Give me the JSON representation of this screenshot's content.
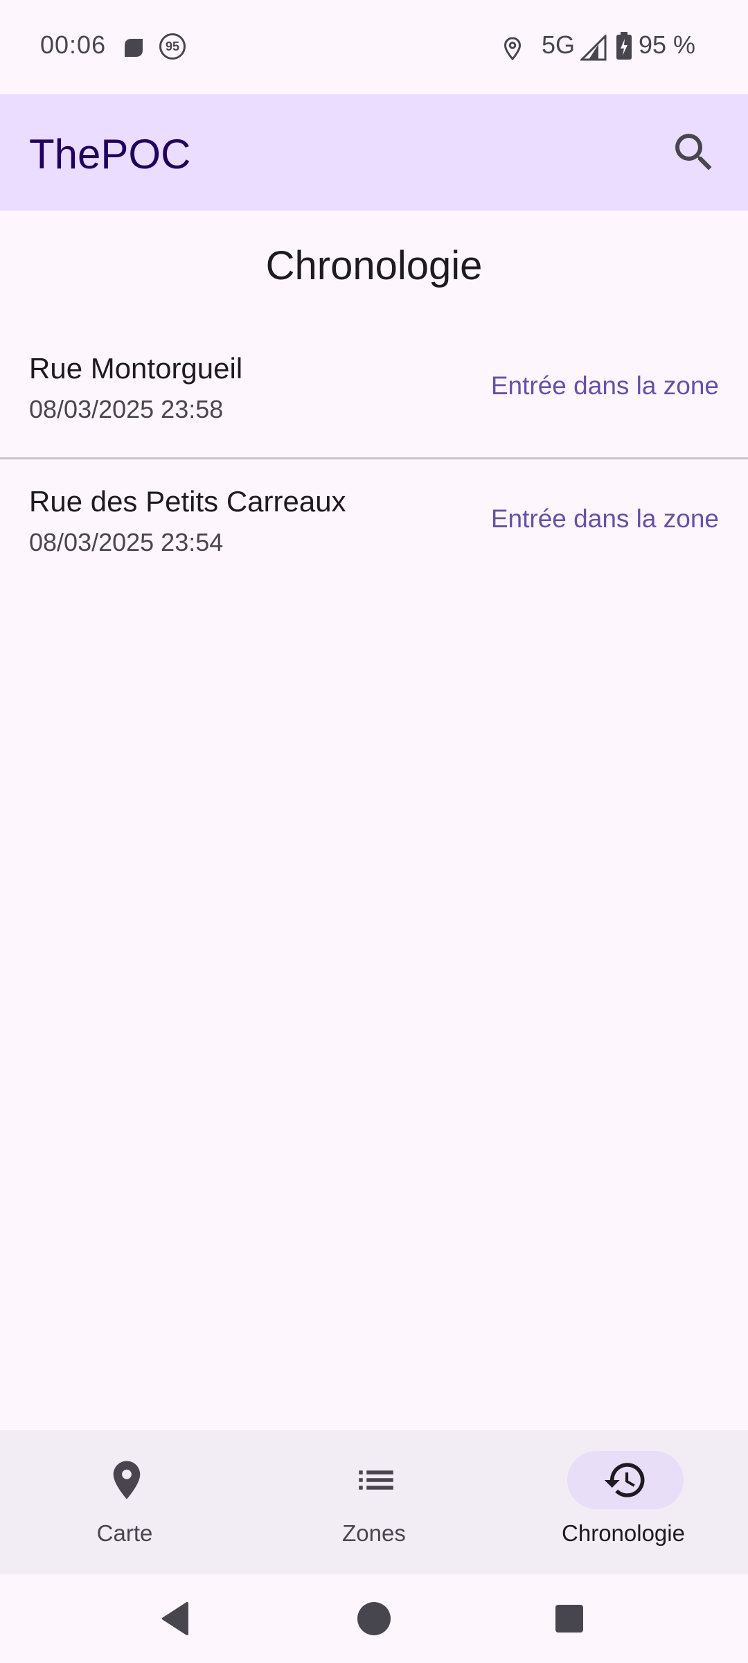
{
  "status_bar": {
    "time": "00:06",
    "network": "5G",
    "battery": "95 %",
    "notification_badge": "95",
    "icons": [
      "app-notification-icon",
      "badge-icon",
      "location-icon",
      "signal-icon",
      "battery-icon"
    ]
  },
  "app_bar": {
    "title": "ThePOC",
    "search_icon": "search-icon"
  },
  "page": {
    "title": "Chronologie"
  },
  "timeline": [
    {
      "name": "Rue Montorgueil",
      "date": "08/03/2025 23:58",
      "action": "Entrée dans la zone"
    },
    {
      "name": "Rue des Petits Carreaux",
      "date": "08/03/2025 23:54",
      "action": "Entrée dans la zone"
    }
  ],
  "bottom_nav": {
    "items": [
      {
        "label": "Carte",
        "icon": "map-pin-icon",
        "active": false
      },
      {
        "label": "Zones",
        "icon": "list-icon",
        "active": false
      },
      {
        "label": "Chronologie",
        "icon": "history-icon",
        "active": true
      }
    ]
  },
  "system_nav": {
    "buttons": [
      "back-icon",
      "home-icon",
      "recents-icon"
    ]
  },
  "colors": {
    "app_bar_bg": "#eaddff",
    "title": "#21005d",
    "accent": "#6750a4",
    "background": "#fdf7fd",
    "nav_bg": "#f2edf4",
    "active_indicator": "#e8def8"
  }
}
